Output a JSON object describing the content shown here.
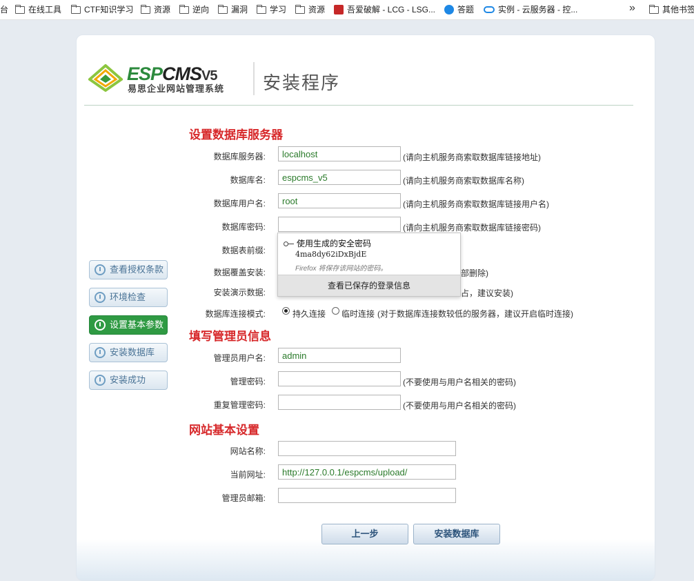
{
  "bookmarks": {
    "cut_item": "台",
    "items": [
      {
        "label": "在线工具",
        "icon": "folder-icon"
      },
      {
        "label": "CTF知识学习",
        "icon": "folder-icon"
      },
      {
        "label": "资源",
        "icon": "folder-icon"
      },
      {
        "label": "逆向",
        "icon": "folder-icon"
      },
      {
        "label": "漏洞",
        "icon": "folder-icon"
      },
      {
        "label": "学习",
        "icon": "folder-icon"
      },
      {
        "label": "资源",
        "icon": "folder-icon"
      },
      {
        "label": "吾爱破解 - LCG - LSG...",
        "icon": "site-icon"
      },
      {
        "label": "答题",
        "icon": "site-icon"
      },
      {
        "label": "实例 - 云服务器 - 控...",
        "icon": "cloud-icon"
      }
    ],
    "overflow_icon": "chevron-double-right-icon",
    "other": "其他书签"
  },
  "header": {
    "logo_brand_esp": "ESP",
    "logo_brand_cms": "CMS",
    "logo_version": "V5",
    "logo_subtitle": "易思企业网站管理系统",
    "title": "安装程序"
  },
  "steps": [
    {
      "label": "查看授权条款",
      "active": false
    },
    {
      "label": "环境检查",
      "active": false
    },
    {
      "label": "设置基本参数",
      "active": true
    },
    {
      "label": "安装数据库",
      "active": false
    },
    {
      "label": "安装成功",
      "active": false
    }
  ],
  "db": {
    "section_title": "设置数据库服务器",
    "server": {
      "label": "数据库服务器:",
      "value": "localhost",
      "note": "(请向主机服务商索取数据库链接地址)"
    },
    "name": {
      "label": "数据库名:",
      "value": "espcms_v5",
      "note": "(请向主机服务商索取数据库名称)"
    },
    "user": {
      "label": "数据库用户名:",
      "value": "root",
      "note": "(请向主机服务商索取数据库链接用户名)"
    },
    "password": {
      "label": "数据库密码:",
      "value": "",
      "note": "(请向主机服务商索取数据库链接密码)"
    },
    "prefix": {
      "label": "数据表前缀:"
    },
    "overwrite": {
      "label": "数据覆盖安装:",
      "note_tail": "部删除)"
    },
    "demo": {
      "label": "安装演示数据:",
      "note_tail": "占，建议安装)"
    },
    "connect_mode": {
      "label": "数据库连接模式:",
      "options": [
        "持久连接",
        "临时连接"
      ],
      "selected": "持久连接",
      "note": "(对于数据库连接数较低的服务器，建议开启临时连接)"
    }
  },
  "password_popup": {
    "title": "使用生成的安全密码",
    "generated": "4ma8dy62iDxBjdE",
    "hint": "Firefox 将保存该网站的密码。",
    "button": "查看已保存的登录信息"
  },
  "admin": {
    "section_title": "填写管理员信息",
    "username": {
      "label": "管理员用户名:",
      "value": "admin"
    },
    "password": {
      "label": "管理密码:",
      "value": "",
      "note": "(不要使用与用户名相关的密码)"
    },
    "password_repeat": {
      "label": "重复管理密码:",
      "value": "",
      "note": "(不要使用与用户名相关的密码)"
    }
  },
  "site": {
    "section_title": "网站基本设置",
    "name": {
      "label": "网站名称:",
      "value": ""
    },
    "url": {
      "label": "当前网址:",
      "value": "http://127.0.0.1/espcms/upload/"
    },
    "email": {
      "label": "管理员邮箱:",
      "value": ""
    }
  },
  "buttons": {
    "prev": "上一步",
    "install": "安装数据库"
  },
  "colors": {
    "accent_red": "#d7292b",
    "active_step_green": "#2f9a43",
    "input_text_green": "#2a7a2a"
  }
}
